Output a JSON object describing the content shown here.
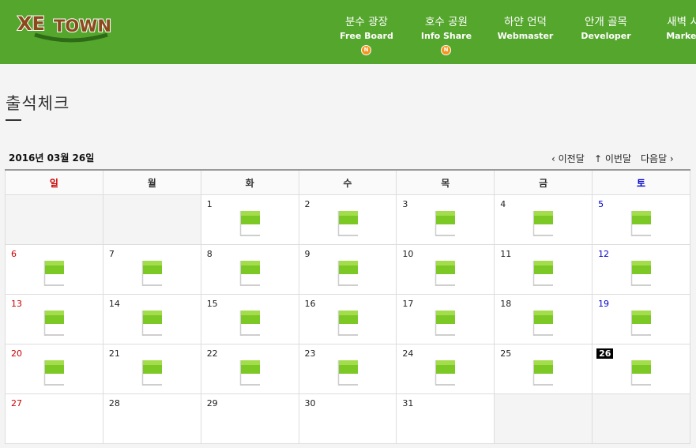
{
  "site": {
    "logo_text": "XE TOWN"
  },
  "nav": [
    {
      "ko": "분수 광장",
      "en": "Free Board",
      "badge": "N"
    },
    {
      "ko": "호수 공원",
      "en": "Info Share",
      "badge": "N"
    },
    {
      "ko": "하얀 언덕",
      "en": "Webmaster",
      "badge": ""
    },
    {
      "ko": "안개 골목",
      "en": "Developer",
      "badge": ""
    },
    {
      "ko": "새벽 시",
      "en": "Market",
      "badge": ""
    }
  ],
  "page": {
    "title": "출석체크",
    "current_date": "2016년 03월 26일"
  },
  "month_nav": {
    "prev": "‹ 이전달",
    "current": "↑ 이번달",
    "next": "다음달 ›"
  },
  "weekdays": [
    "일",
    "월",
    "화",
    "수",
    "목",
    "금",
    "토"
  ],
  "calendar": {
    "weeks": [
      [
        "",
        "",
        "1",
        "2",
        "3",
        "4",
        "5"
      ],
      [
        "6",
        "7",
        "8",
        "9",
        "10",
        "11",
        "12"
      ],
      [
        "13",
        "14",
        "15",
        "16",
        "17",
        "18",
        "19"
      ],
      [
        "20",
        "21",
        "22",
        "23",
        "24",
        "25",
        "26"
      ],
      [
        "27",
        "28",
        "29",
        "30",
        "31",
        "",
        ""
      ]
    ],
    "today": "26",
    "checked_days": [
      "1",
      "2",
      "3",
      "4",
      "5",
      "6",
      "7",
      "8",
      "9",
      "10",
      "11",
      "12",
      "13",
      "14",
      "15",
      "16",
      "17",
      "18",
      "19",
      "20",
      "21",
      "22",
      "23",
      "24",
      "25",
      "26"
    ],
    "icon": "green-flag-icon"
  },
  "colors": {
    "header": "#55a62d",
    "sunday": "#cc0000",
    "saturday": "#0000cc",
    "flag": "#7cc825",
    "badge": "#f7941d"
  }
}
